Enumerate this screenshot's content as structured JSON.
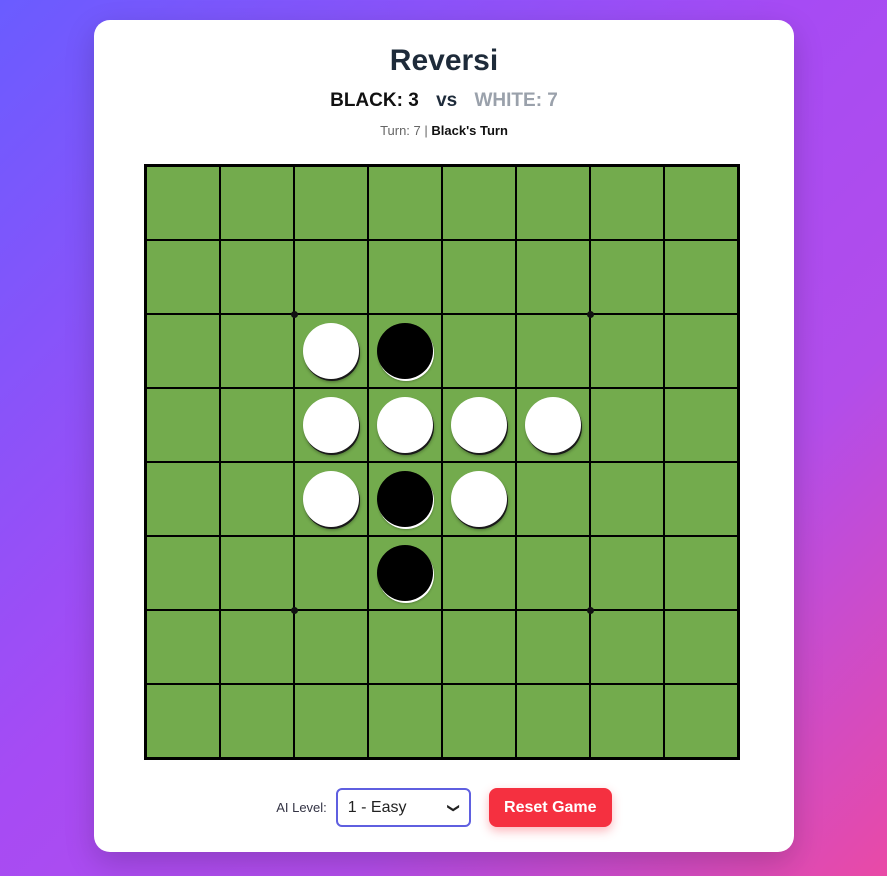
{
  "title": "Reversi",
  "scoreboard": {
    "black_label": "BLACK: 3",
    "vs": "vs",
    "white_label": "WHITE: 7"
  },
  "status": {
    "turn_text": "Turn: 7 |",
    "turn_player": "Black's Turn"
  },
  "board": {
    "size": 8,
    "colors": {
      "cell": "#73ab4d",
      "line": "#000000",
      "black": "#000000",
      "white": "#ffffff"
    },
    "pieces": [
      {
        "row": 2,
        "col": 2,
        "color": "white"
      },
      {
        "row": 2,
        "col": 3,
        "color": "black"
      },
      {
        "row": 3,
        "col": 2,
        "color": "white"
      },
      {
        "row": 3,
        "col": 3,
        "color": "white"
      },
      {
        "row": 3,
        "col": 4,
        "color": "white"
      },
      {
        "row": 3,
        "col": 5,
        "color": "white"
      },
      {
        "row": 4,
        "col": 2,
        "color": "white"
      },
      {
        "row": 4,
        "col": 3,
        "color": "black"
      },
      {
        "row": 4,
        "col": 4,
        "color": "white"
      },
      {
        "row": 5,
        "col": 3,
        "color": "black"
      }
    ]
  },
  "controls": {
    "ai_label": "AI Level:",
    "ai_selected": "1 - Easy",
    "reset_label": "Reset Game"
  },
  "theme": {
    "accent_reset": "#f53040",
    "select_border": "#5f5fe0"
  }
}
